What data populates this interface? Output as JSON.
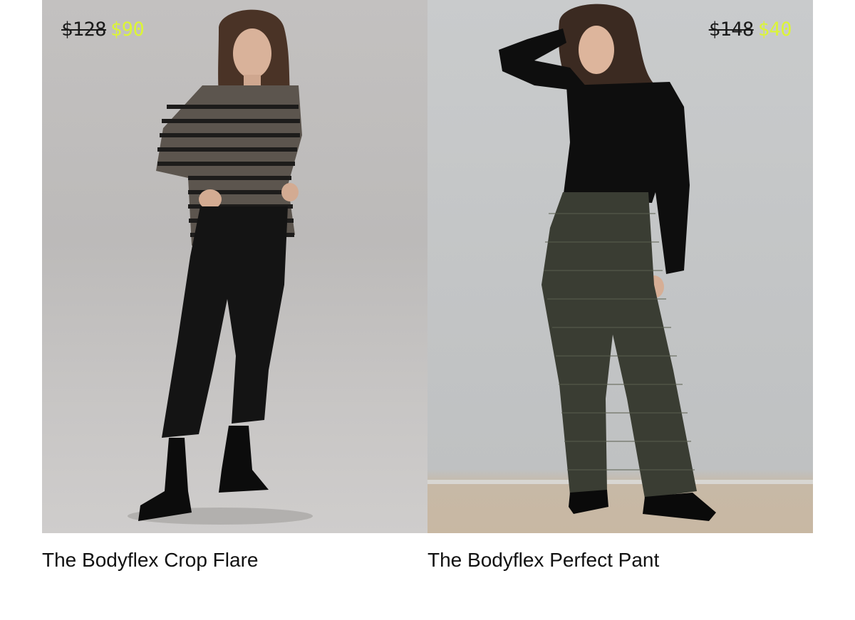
{
  "products": [
    {
      "name": "The Bodyflex Crop Flare",
      "original_price": "$128",
      "sale_price": "$90"
    },
    {
      "name": "The Bodyflex Perfect Pant",
      "original_price": "$148",
      "sale_price": "$40"
    }
  ],
  "colors": {
    "sale_price": "#dcf536",
    "original_price": "#1b1b1b",
    "title": "#111111"
  }
}
